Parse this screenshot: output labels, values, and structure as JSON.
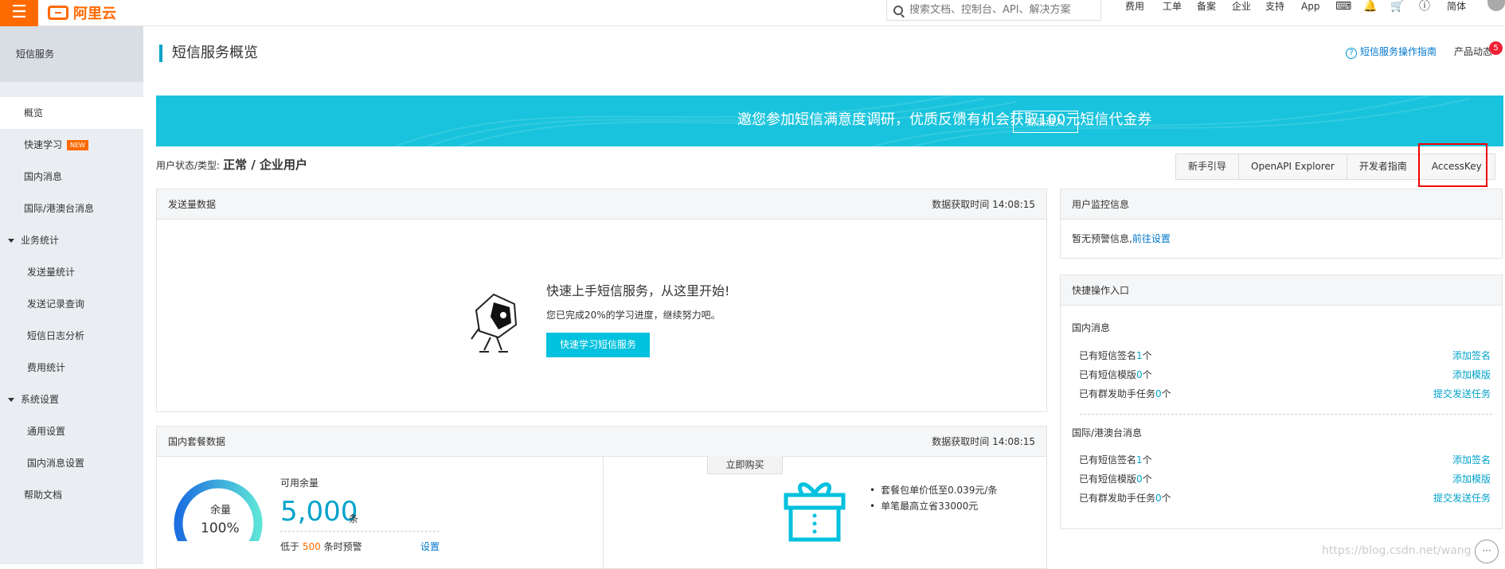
{
  "topbar": {
    "menu_icon": "hamburger-icon",
    "logo_text": "阿里云",
    "search_placeholder": "搜索文档、控制台、API、解决方案",
    "nav": [
      "费用",
      "工单",
      "备案",
      "企业",
      "支持",
      "App"
    ],
    "lang": "简体"
  },
  "sidebar": {
    "header": "短信服务",
    "items": [
      {
        "label": "概览",
        "active": true
      },
      {
        "label": "快速学习",
        "badge": "NEW"
      },
      {
        "label": "国内消息"
      },
      {
        "label": "国际/港澳台消息"
      },
      {
        "label": "业务统计",
        "group": true
      },
      {
        "label": "发送量统计"
      },
      {
        "label": "发送记录查询"
      },
      {
        "label": "短信日志分析"
      },
      {
        "label": "费用统计"
      },
      {
        "label": "系统设置",
        "group": true
      },
      {
        "label": "通用设置"
      },
      {
        "label": "国内消息设置"
      },
      {
        "label": "帮助文档"
      }
    ]
  },
  "page": {
    "title": "短信服务概览",
    "guide_link": "短信服务操作指南",
    "news_label": "产品动态",
    "news_badge": "5"
  },
  "banner": {
    "text": "邀您参加短信满意度调研，优质反馈有机会获取100元短信代金券",
    "button": "点击进入",
    "color": "#19c3dd"
  },
  "user_status": {
    "label": "用户状态/类型:",
    "value": "正常 / 企业用户"
  },
  "tabs": [
    "新手引导",
    "OpenAPI Explorer",
    "开发者指南",
    "AccessKey"
  ],
  "send_panel": {
    "title": "发送量数据",
    "time": "数据获取时间 14:08:15",
    "quickstart_title": "快速上手短信服务，从这里开始!",
    "quickstart_sub": "您已完成20%的学习进度，继续努力吧。",
    "quickstart_button": "快速学习短信服务"
  },
  "package_panel": {
    "title": "国内套餐数据",
    "time": "数据获取时间 14:08:15",
    "gauge_label": "余量",
    "gauge_percent": "100%",
    "gauge_fraction": 1.0,
    "available_label": "可用余量",
    "available_value": "5,000",
    "available_unit": "条",
    "warn_prefix": "低于",
    "warn_value": "500",
    "warn_suffix": "条时预警",
    "warn_setting": "设置",
    "buy_button": "立即购买",
    "bullets": [
      "套餐包单价低至0.039元/条",
      "单笔最高立省33000元"
    ]
  },
  "monitor_panel": {
    "title": "用户监控信息",
    "text": "暂无预警信息,",
    "link": "前往设置"
  },
  "quick_panel": {
    "title": "快捷操作入口",
    "domestic": {
      "heading": "国内消息",
      "rows": [
        {
          "prefix": "已有短信签名",
          "count": "1",
          "suffix": "个",
          "link": "添加签名"
        },
        {
          "prefix": "已有短信模版",
          "count": "0",
          "suffix": "个",
          "link": "添加模版"
        },
        {
          "prefix": "已有群发助手任务",
          "count": "0",
          "suffix": "个",
          "link": "提交发送任务"
        }
      ]
    },
    "intl": {
      "heading": "国际/港澳台消息",
      "rows": [
        {
          "prefix": "已有短信签名",
          "count": "1",
          "suffix": "个",
          "link": "添加签名"
        },
        {
          "prefix": "已有短信模版",
          "count": "0",
          "suffix": "个",
          "link": "添加模版"
        },
        {
          "prefix": "已有群发助手任务",
          "count": "0",
          "suffix": "个",
          "link": "提交发送任务"
        }
      ]
    }
  },
  "watermark": "https://blog.csdn.net/wang"
}
